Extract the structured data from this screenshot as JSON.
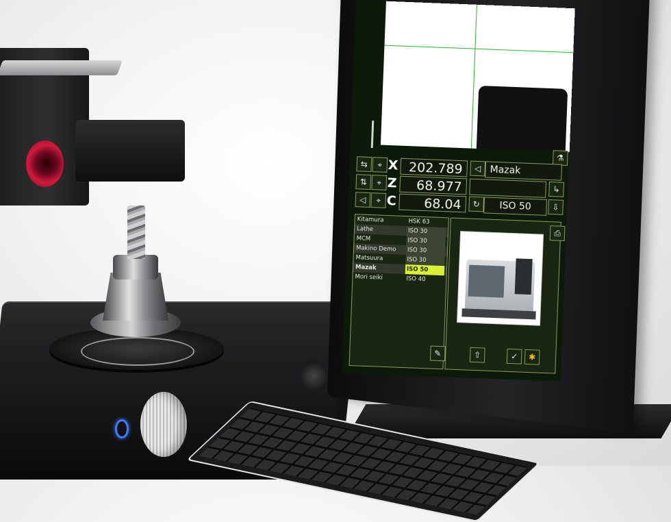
{
  "readouts": {
    "x_label": "X",
    "x_value": "202.789",
    "z_label": "Z",
    "z_value": "68.977",
    "c_label": "C",
    "c_value": "68.04"
  },
  "machine_field": "Mazak",
  "spindle_field": "ISO 50",
  "machine_list": [
    {
      "name": "Kitamura",
      "spindle": "HSK 63"
    },
    {
      "name": "Lathe",
      "spindle": "ISO 30"
    },
    {
      "name": "MCM",
      "spindle": "ISO 30"
    },
    {
      "name": "Makino Demo",
      "spindle": "ISO 30"
    },
    {
      "name": "Matsuura",
      "spindle": "ISO 30"
    },
    {
      "name": "Mazak",
      "spindle": "ISO 50"
    },
    {
      "name": "Mori seiki",
      "spindle": "ISO 40"
    }
  ],
  "selected_index": 5,
  "colors": {
    "ui_border": "#8c9a62",
    "ui_background": "#1a2612",
    "crosshair": "#2bb12b",
    "selection": "#d9ef3a"
  },
  "icons": {
    "confirm": "check-icon",
    "edit": "edit-icon",
    "navigate": "nav-icon",
    "settings": "gear-icon"
  }
}
